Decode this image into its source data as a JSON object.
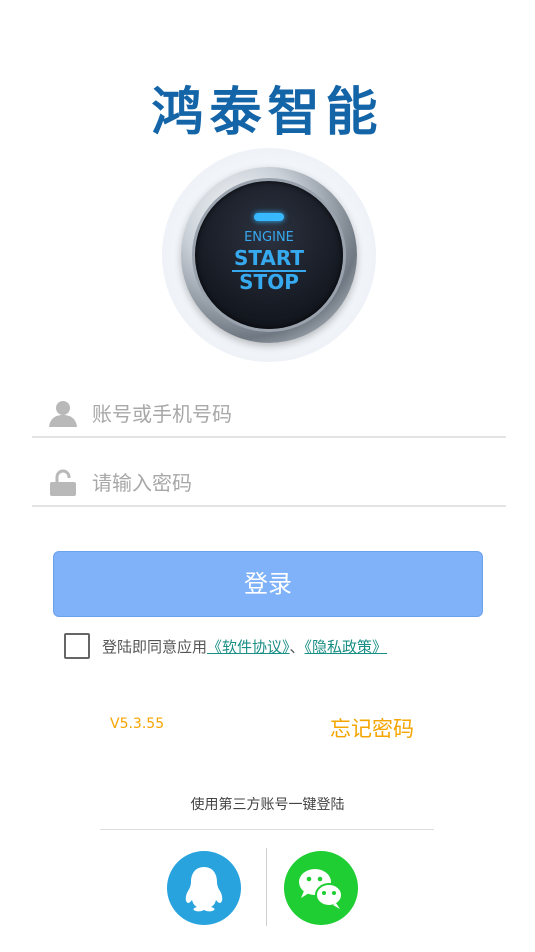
{
  "brand": {
    "logo_text": "鸿泰智能"
  },
  "engine_button": {
    "line1": "ENGINE",
    "line2": "START",
    "line3": "STOP"
  },
  "form": {
    "account_placeholder": "账号或手机号码",
    "password_placeholder": "请输入密码",
    "login_label": "登录"
  },
  "agreement": {
    "prefix": "登陆即同意应用",
    "link_software": "《软件协议》",
    "separator": "、",
    "link_privacy": "《隐私政策》",
    "checked": false
  },
  "footer": {
    "version": "V5.3.55",
    "forgot_password": "忘记密码",
    "third_party_title": "使用第三方账号一键登陆"
  },
  "colors": {
    "brand_blue": "#1464a8",
    "button_blue": "#7fb2f8",
    "orange": "#f5a500",
    "qq_blue": "#29a3de",
    "wechat_green": "#1fce33",
    "link_teal": "#1a8f86"
  }
}
